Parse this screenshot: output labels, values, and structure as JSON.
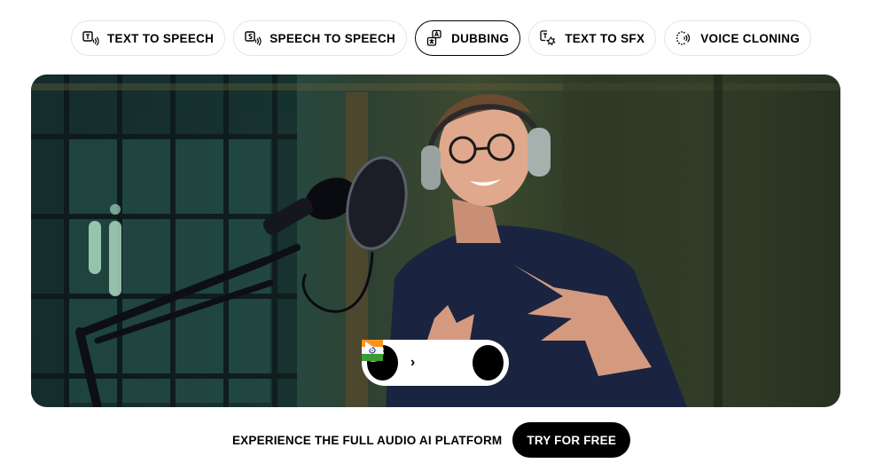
{
  "tabs": [
    {
      "label": "TEXT TO SPEECH",
      "icon": "text-to-speech-icon",
      "active": false
    },
    {
      "label": "SPEECH TO SPEECH",
      "icon": "speech-to-speech-icon",
      "active": false
    },
    {
      "label": "DUBBING",
      "icon": "dubbing-translate-icon",
      "active": true
    },
    {
      "label": "TEXT TO SFX",
      "icon": "text-to-sfx-icon",
      "active": false
    },
    {
      "label": "VOICE CLONING",
      "icon": "voice-cloning-icon",
      "active": false
    }
  ],
  "hero": {
    "image_description": "Smiling man with glasses and headphones gesturing in front of a studio microphone with pop filter",
    "dubbing_control": {
      "source_language_flag": "us-flag-icon",
      "target_language_flag": "india-flag-icon",
      "arrow": "›",
      "play_icon": "play-icon"
    }
  },
  "cta": {
    "text": "EXPERIENCE THE FULL AUDIO AI PLATFORM",
    "button_label": "TRY FOR FREE"
  },
  "colors": {
    "accent": "#000000",
    "background": "#ffffff",
    "tab_border": "#e5e5e5"
  }
}
